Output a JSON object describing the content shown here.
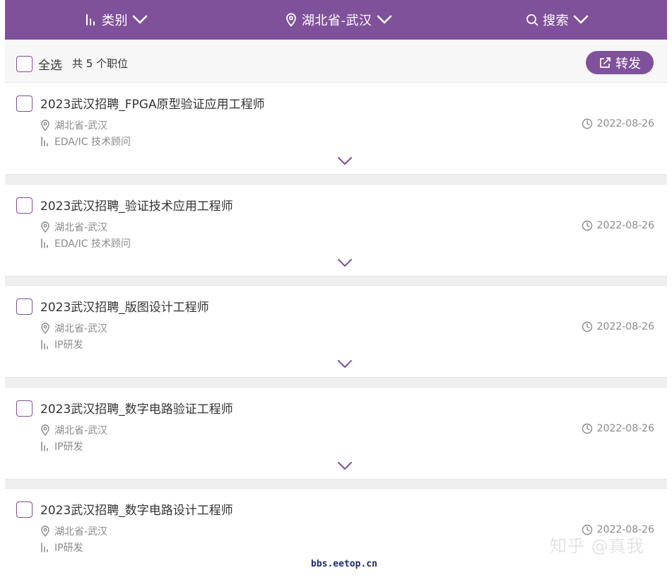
{
  "topbar": {
    "filters": [
      {
        "label": "类别",
        "icon": "bar-chart-icon"
      },
      {
        "label": "湖北省-武汉",
        "icon": "location-pin-icon"
      },
      {
        "label": "搜索",
        "icon": "search-icon"
      }
    ],
    "background_color": "#80519b"
  },
  "toolbar": {
    "select_all_label": "全选",
    "count_label": "共 5 个职位",
    "share_label": "转发",
    "share_icon": "share-external-icon"
  },
  "jobs": [
    {
      "title": "2023武汉招聘_FPGA原型验证应用工程师",
      "location": "湖北省-武汉",
      "category": "EDA/IC 技术顾问",
      "date": "2022-08-26"
    },
    {
      "title": "2023武汉招聘_验证技术应用工程师",
      "location": "湖北省-武汉",
      "category": "EDA/IC 技术顾问",
      "date": "2022-08-26"
    },
    {
      "title": "2023武汉招聘_版图设计工程师",
      "location": "湖北省-武汉",
      "category": "IP研发",
      "date": "2022-08-26"
    },
    {
      "title": "2023武汉招聘_数字电路验证工程师",
      "location": "湖北省-武汉",
      "category": "IP研发",
      "date": "2022-08-26"
    },
    {
      "title": "2023武汉招聘_数字电路设计工程师",
      "location": "湖北省-武汉",
      "category": "IP研发",
      "date": "2022-08-26"
    }
  ],
  "watermark": {
    "text": "知乎 @真我",
    "site": "bbs.eetop.cn"
  }
}
